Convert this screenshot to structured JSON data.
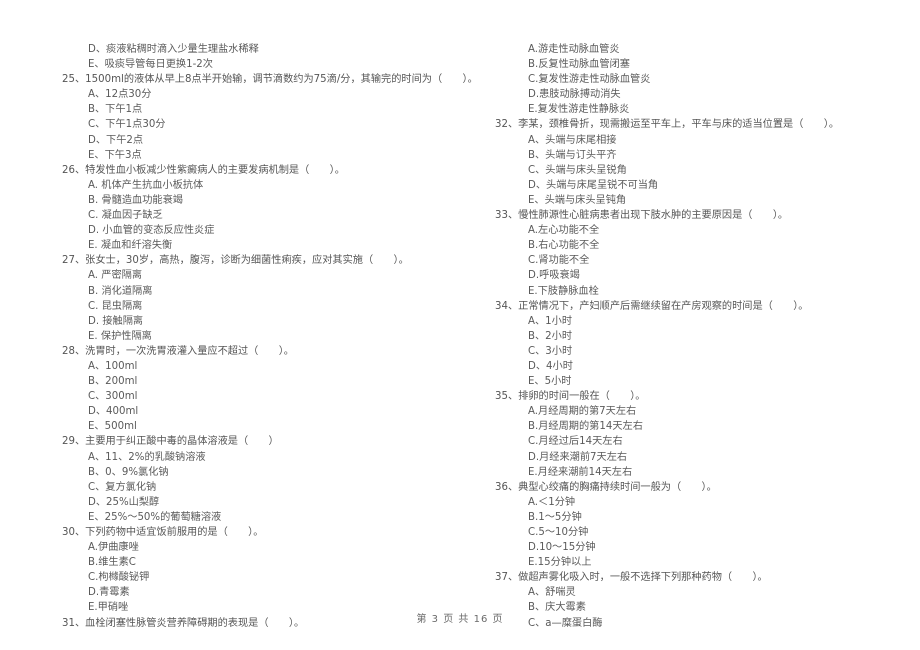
{
  "document": {
    "type": "scanned-exam-paper",
    "footer": "第 3 页 共 16 页",
    "page_number": 3,
    "total_pages": 16
  },
  "left_column": {
    "orphan_options": [
      "D、痰液粘稠时滴入少量生理盐水稀释",
      "E、吸痰导管每日更换1-2次"
    ],
    "questions": [
      {
        "number": "25",
        "stem": "25、1500ml的液体从早上8点半开始输，调节滴数约为75滴/分，其输完的时间为（　　）。",
        "options": [
          "A、12点30分",
          "B、下午1点",
          "C、下午1点30分",
          "D、下午2点",
          "E、下午3点"
        ]
      },
      {
        "number": "26",
        "stem": "26、特发性血小板减少性紫癜病人的主要发病机制是（　　）。",
        "options": [
          "A. 机体产生抗血小板抗体",
          "B. 骨髓造血功能衰竭",
          "C. 凝血因子缺乏",
          "D. 小血管的变态反应性炎症",
          "E. 凝血和纤溶失衡"
        ]
      },
      {
        "number": "27",
        "stem": "27、张女士，30岁，高热，腹泻，诊断为细菌性痢疾，应对其实施（　　）。",
        "options": [
          "A. 严密隔离",
          "B. 消化道隔离",
          "C. 昆虫隔离",
          "D. 接触隔离",
          "E. 保护性隔离"
        ]
      },
      {
        "number": "28",
        "stem": "28、洗胃时，一次洗胃液灌入量应不超过（　　）。",
        "options": [
          "A、100ml",
          "B、200ml",
          "C、300ml",
          "D、400ml",
          "E、500ml"
        ]
      },
      {
        "number": "29",
        "stem": "29、主要用于纠正酸中毒的晶体溶液是（　　）",
        "options": [
          "A、11、2%的乳酸钠溶液",
          "B、0、9%氯化钠",
          "C、复方氯化钠",
          "D、25%山梨醇",
          "E、25%～50%的葡萄糖溶液"
        ]
      },
      {
        "number": "30",
        "stem": "30、下列药物中适宜饭前服用的是（　　）。",
        "options": [
          "A.伊曲康唑",
          "B.维生素C",
          "C.枸橼酸铋钾",
          "D.青霉素",
          "E.甲硝唑"
        ]
      },
      {
        "number": "31",
        "stem": "31、血栓闭塞性脉管炎营养障碍期的表现是（　　）。",
        "options": []
      }
    ]
  },
  "right_column": {
    "orphan_options": [
      "A.游走性动脉血管炎",
      "B.反复性动脉血管闭塞",
      "C.复发性游走性动脉血管炎",
      "D.患肢动脉搏动消失",
      "E.复发性游走性静脉炎"
    ],
    "questions": [
      {
        "number": "32",
        "stem": "32、李某，颈椎骨折，现需搬运至平车上，平车与床的适当位置是（　　）。",
        "options": [
          "A、头端与床尾相接",
          "B、头端与订头平齐",
          "C、头端与床头呈锐角",
          "D、头端与床尾呈锐不可当角",
          "E、头端与床头呈钝角"
        ]
      },
      {
        "number": "33",
        "stem": "33、慢性肺源性心脏病患者出现下肢水肿的主要原因是（　　）。",
        "options": [
          "A.左心功能不全",
          "B.右心功能不全",
          "C.肾功能不全",
          "D.呼吸衰竭",
          "E.下肢静脉血栓"
        ]
      },
      {
        "number": "34",
        "stem": "34、正常情况下，产妇顺产后需继续留在产房观察的时间是（　　）。",
        "options": [
          "A、1小时",
          "B、2小时",
          "C、3小时",
          "D、4小时",
          "E、5小时"
        ]
      },
      {
        "number": "35",
        "stem": "35、排卵的时间一般在（　　）。",
        "options": [
          "A.月经周期的第7天左右",
          "B.月经周期的第14天左右",
          "C.月经过后14天左右",
          "D.月经来潮前7天左右",
          "E.月经来潮前14天左右"
        ]
      },
      {
        "number": "36",
        "stem": "36、典型心绞痛的胸痛持续时间一般为（　　）。",
        "options": [
          "A.＜1分钟",
          "B.1～5分钟",
          "C.5～10分钟",
          "D.10～15分钟",
          "E.15分钟以上"
        ]
      },
      {
        "number": "37",
        "stem": "37、做超声雾化吸入时，一般不选择下列那种药物（　　）。",
        "options": [
          "A、舒喘灵",
          "B、庆大霉素",
          "C、a—糜蛋白酶"
        ]
      }
    ]
  }
}
